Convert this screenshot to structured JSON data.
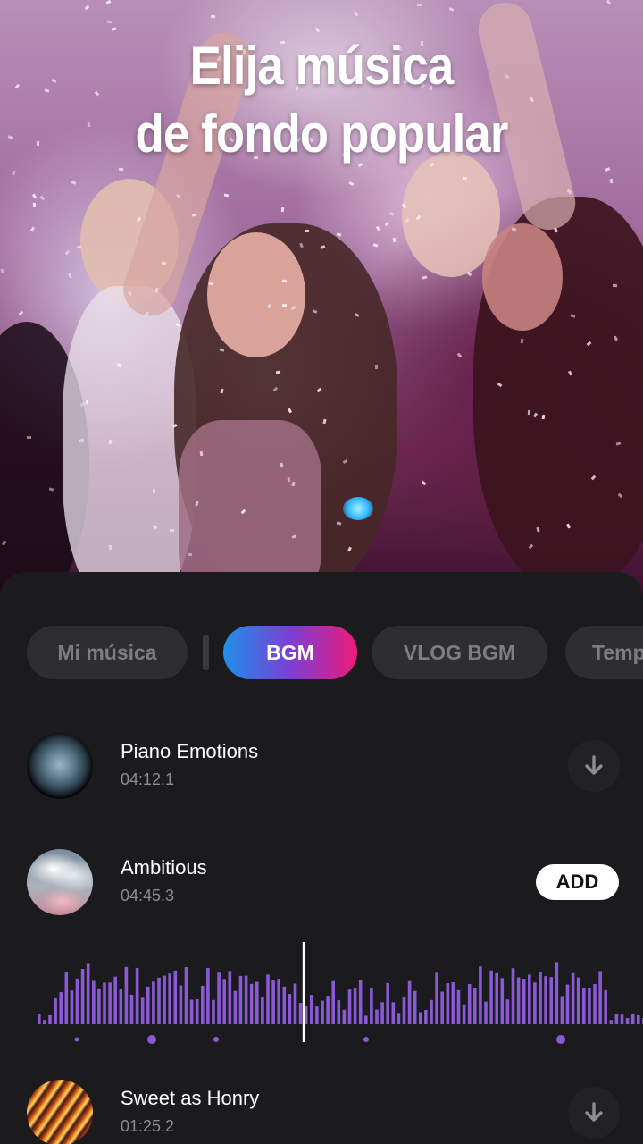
{
  "hero": {
    "title_line1": "Elija música",
    "title_line2": "de fondo popular"
  },
  "tabs": [
    {
      "label": "Mi música",
      "active": false
    },
    {
      "label": "BGM",
      "active": true
    },
    {
      "label": "VLOG BGM",
      "active": false
    },
    {
      "label": "Temp",
      "active": false
    }
  ],
  "tracks": [
    {
      "title": "Piano Emotions",
      "duration": "04:12.1",
      "action": "download-icon"
    },
    {
      "title": "Ambitious",
      "duration": "04:45.3",
      "action_label": "ADD"
    },
    {
      "title": "Sweet as Honry",
      "duration": "01:25.2",
      "action": "download-icon"
    }
  ],
  "player": {
    "playhead_progress": 0.44
  },
  "colors": {
    "accent_blue": "#1f8fe8",
    "accent_pink": "#ee1a7a",
    "waveform": "#8a5ad6",
    "sheet_bg": "#1b1b1d"
  }
}
